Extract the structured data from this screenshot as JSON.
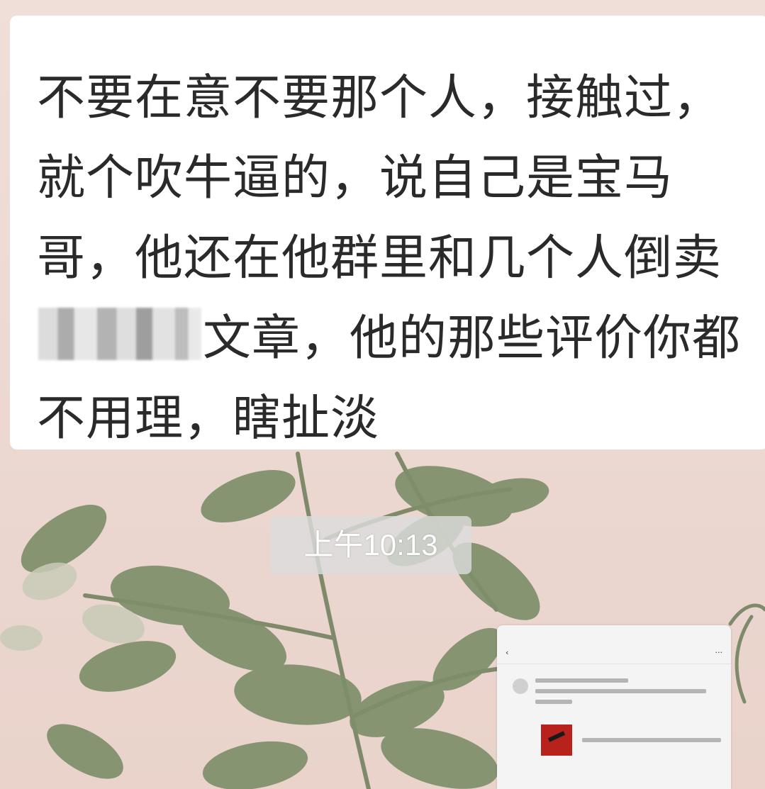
{
  "message": {
    "text_before": "不要在意不要那个人，接触过，就个吹牛逼的，说自己是宝马哥，他还在他群里和几个人倒卖",
    "text_after": "文章，他的那些评价你都不用理，瞎扯淡"
  },
  "timestamp": "上午10:13",
  "thumbnail": {
    "screenshot": "shared-screenshot"
  }
}
